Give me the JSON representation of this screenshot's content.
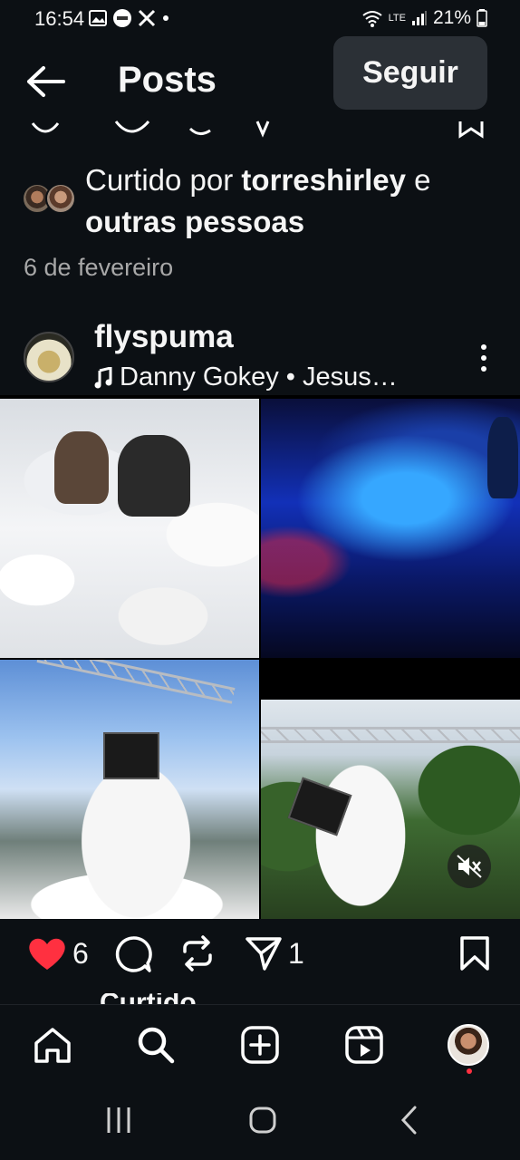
{
  "status_bar": {
    "time": "16:54",
    "battery": "21%",
    "network_label": "LTE"
  },
  "header": {
    "title": "Posts",
    "follow_button": "Seguir"
  },
  "liked_by": {
    "prefix": "Curtido por ",
    "username": "torreshirley",
    "suffix_1": " e",
    "suffix_2": "outras pessoas"
  },
  "date": "6 de fevereiro",
  "post": {
    "username": "flyspuma",
    "audio": "Danny Gokey • Jesus…",
    "likes": "6",
    "shares": "1"
  },
  "next_caption_peek": "Curtido",
  "icons": {
    "back": "arrow-left-icon",
    "like": "heart-filled-icon",
    "comment": "comment-icon",
    "repost": "repost-icon",
    "share": "send-icon",
    "save": "bookmark-icon",
    "more": "more-vertical-icon",
    "music": "music-note-icon",
    "mute": "speaker-muted-icon",
    "home": "home-icon",
    "search": "search-icon",
    "create": "create-icon",
    "reels": "reels-icon"
  },
  "colors": {
    "background": "#0c1014",
    "like_red": "#ff3040",
    "follow_bg": "#2b3036",
    "muted_text": "#a8a8a8"
  }
}
